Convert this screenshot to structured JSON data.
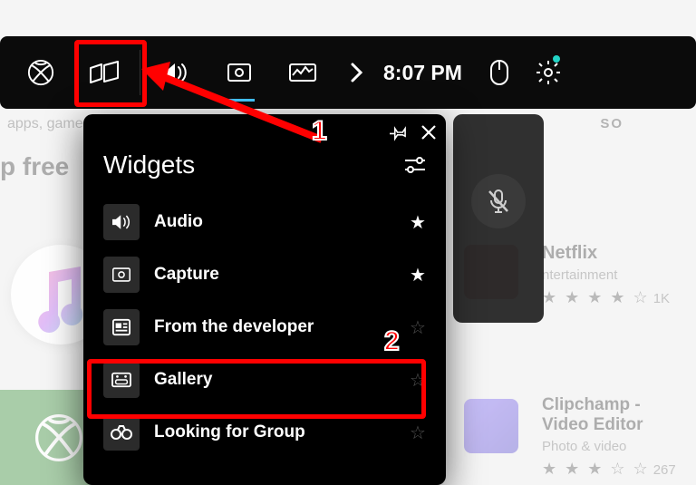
{
  "colors": {
    "annotation": "#ff0000",
    "accent": "#44c8ff",
    "teal_dot": "#22d3c5",
    "xbox_green": "#107c10"
  },
  "background": {
    "search_hint": "apps, games, mo",
    "top_free_label": "p free",
    "so_badge": "SO",
    "apps": [
      {
        "title": "Netflix",
        "category": "ntertainment",
        "stars_filled": 4,
        "stars_total": 5,
        "count": "1K"
      },
      {
        "title": "Clipchamp - Video Editor",
        "category": "Photo & video",
        "stars_filled": 3,
        "stars_total": 5,
        "count": "267"
      }
    ]
  },
  "gamebar": {
    "time": "8:07 PM",
    "items": [
      {
        "id": "xbox",
        "icon": "xbox-icon"
      },
      {
        "id": "widgets",
        "icon": "widgets-icon"
      },
      {
        "id": "audio",
        "icon": "speaker-icon"
      },
      {
        "id": "capture",
        "icon": "capture-icon",
        "active": true
      },
      {
        "id": "perf",
        "icon": "performance-icon"
      }
    ],
    "right": [
      {
        "id": "mouse",
        "icon": "mouse-icon"
      },
      {
        "id": "settings",
        "icon": "gear-icon",
        "badge": true
      }
    ]
  },
  "mic_panel": {
    "muted_icon": "mic-muted-icon"
  },
  "widgets_panel": {
    "title": "Widgets",
    "pin_icon": "pin-icon",
    "close_icon": "close-icon",
    "settings_icon": "sliders-icon",
    "items": [
      {
        "label": "Audio",
        "icon": "speaker-icon",
        "favorite": true
      },
      {
        "label": "Capture",
        "icon": "capture-icon",
        "favorite": true
      },
      {
        "label": "From the developer",
        "icon": "news-icon",
        "favorite": false
      },
      {
        "label": "Gallery",
        "icon": "gallery-icon",
        "favorite": false
      },
      {
        "label": "Looking for Group",
        "icon": "binoculars-icon",
        "favorite": false
      }
    ]
  },
  "annotations": {
    "step1": "1",
    "step2": "2"
  }
}
